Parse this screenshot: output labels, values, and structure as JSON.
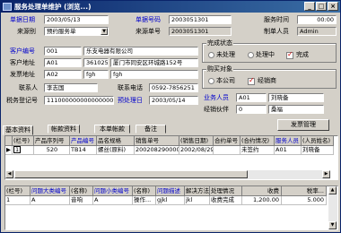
{
  "window": {
    "title": "服务处理单维护 (浏览...)",
    "min": "_",
    "max": "□",
    "close": "×"
  },
  "header": {
    "doc_date_label": "单据日期",
    "doc_date": "2003/05/13",
    "doc_no_label": "单据号码",
    "doc_no": "2003051301",
    "service_time_label": "服务时间",
    "service_time": "00:00",
    "source_label": "来源别",
    "source": "预约服务单",
    "source_no_label": "来源单号",
    "source_no": "2003051301",
    "maker_label": "制单人员",
    "maker": "Admin"
  },
  "customer": {
    "code_label": "客户编号",
    "code": "001",
    "name": "乐支电器有限公司",
    "addr_label": "客户地址",
    "addr_code": "A01",
    "addr_zip": "361025",
    "addr": "厦门市同安区环城路152号",
    "ship_label": "发票地址",
    "ship_code": "A02",
    "ship_1": "fgh",
    "ship_2": "fgh",
    "contact_label": "联系人",
    "contact": "李志国",
    "phone_label": "联系电话",
    "phone": "0592-7856251",
    "tax_label": "税务登记号",
    "tax": "111000000000000000",
    "due_label": "预处理日",
    "due": "2003/05/14"
  },
  "status_group": {
    "title": "完成状态",
    "opt1": "未处理",
    "opt2": "处理中",
    "opt3": "完成"
  },
  "buy_group": {
    "title": "购买对象",
    "opt1": "本公司",
    "opt2": "经销商"
  },
  "biz": {
    "rep_label": "业务人员",
    "rep_code": "A01",
    "rep_name": "刘晓备",
    "dealer_label": "经销伙伴",
    "dealer_code": "0",
    "dealer_name": "桑福"
  },
  "settings_button": "发票管理",
  "tabs": [
    "基本资料",
    "帐款资料",
    "本单帐款",
    "备注"
  ],
  "grid1": {
    "headers": [
      "",
      "(栏号)",
      "产品序列号",
      "产品编号",
      "品名规格",
      "销售单号",
      "(销售日期)",
      "合约单号",
      "(合约情况)",
      "服务人员",
      "(人员姓名)"
    ],
    "header_blue": [
      false,
      false,
      false,
      true,
      false,
      false,
      false,
      false,
      false,
      true,
      false
    ],
    "rows": [
      [
        "▶",
        "1",
        "520",
        "TB14",
        "螺丝(原料)",
        "2002082900001",
        "2002/08/29",
        "",
        "未签约",
        "A01",
        "刘晓备"
      ]
    ]
  },
  "grid2": {
    "headers": [
      "(栏号)",
      "问题大类编号",
      "(名称)",
      "问题小类编号",
      "(名称)",
      "问题描述",
      "解决方法",
      "处理情况",
      "收费",
      "税率..."
    ],
    "header_blue": [
      false,
      true,
      false,
      true,
      false,
      true,
      false,
      false,
      false,
      false
    ],
    "rows": [
      [
        "1",
        "A",
        "音响",
        "A",
        "操作...",
        "gjkl",
        "jkl",
        "收费完成",
        "1,200.00",
        "5.000"
      ]
    ]
  }
}
